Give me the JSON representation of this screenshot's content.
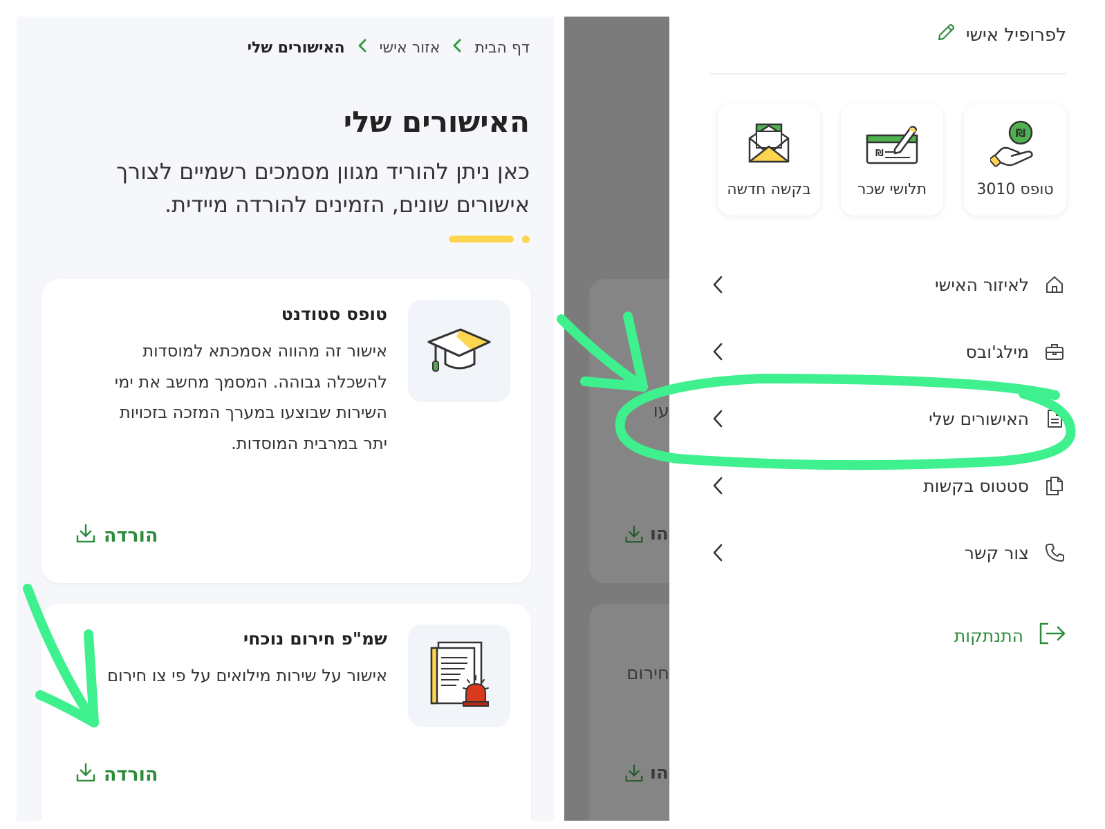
{
  "left": {
    "breadcrumb": {
      "home": "דף הבית",
      "personal": "אזור אישי",
      "current": "האישורים שלי"
    },
    "title": "האישורים שלי",
    "description": "כאן ניתן להוריד מגוון מסמכים רשמיים לצורך אישורים שונים, הזמינים להורדה מיידית.",
    "cards": [
      {
        "title": "טופס סטודנט",
        "description": "אישור זה מהווה אסמכתא למוסדות להשכלה גבוהה. המסמך מחשב את ימי השירות שבוצעו במערך המזכה בזכויות יתר במרבית המוסדות.",
        "download_label": "הורדה",
        "icon": "graduation-cap-icon"
      },
      {
        "title": "שמ\"פ חירום נוכחי",
        "description": "אישור על שירות מילואים על פי צו חירום",
        "download_label": "הורדה",
        "icon": "emergency-document-icon"
      }
    ]
  },
  "right": {
    "background_fragments": {
      "card1_text": "עו",
      "card2_text": "חירום",
      "download_fragment": "הו"
    },
    "profile_link": "לפרופיל אישי",
    "tiles": [
      {
        "label": "טופס 3010",
        "icon": "hand-coin-icon"
      },
      {
        "label": "תלושי שכר",
        "icon": "payslip-icon"
      },
      {
        "label": "בקשה חדשה",
        "icon": "envelope-icon"
      }
    ],
    "menu": [
      {
        "label": "לאיזור האישי",
        "icon": "home-icon"
      },
      {
        "label": "מילג'ובס",
        "icon": "briefcase-icon"
      },
      {
        "label": "האישורים שלי",
        "icon": "document-icon"
      },
      {
        "label": "סטטוס בקשות",
        "icon": "copy-documents-icon"
      },
      {
        "label": "צור קשר",
        "icon": "phone-icon"
      }
    ],
    "logout": "התנתקות"
  },
  "colors": {
    "accent_green": "#2e8b3a",
    "highlight_yellow": "#fdd54f",
    "annotation_green": "#3ef08e"
  }
}
